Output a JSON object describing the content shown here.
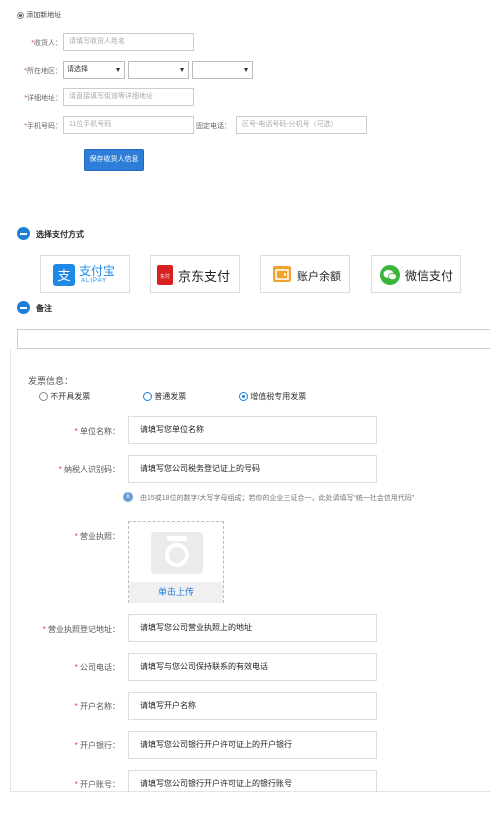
{
  "address": {
    "add_new_label": "添加新地址",
    "receiver": {
      "label": "收货人：",
      "placeholder": "请填写收货人姓名"
    },
    "region": {
      "label": "所在地区：",
      "province_value": "请选择",
      "city_value": "",
      "district_value": ""
    },
    "detail": {
      "label": "详细地址：",
      "placeholder": "请直接填写街道等详细地址"
    },
    "mobile": {
      "label": "手机号码：",
      "placeholder": "11位手机号码"
    },
    "phone": {
      "label": "固定电话：",
      "placeholder": "区号-电话号码-分机号（可选）"
    },
    "save_button": "保存收货人信息"
  },
  "payment": {
    "title": "选择支付方式",
    "methods": [
      {
        "name": "支付宝",
        "sub": "ALIPAY",
        "icon": "alipay-icon",
        "color": "#1e88e5"
      },
      {
        "name": "京东支付",
        "icon": "jd-pay-icon",
        "color": "#d7201f"
      },
      {
        "name": "账户余额",
        "icon": "wallet-icon",
        "color": "#f0a22c"
      },
      {
        "name": "微信支付",
        "icon": "wechat-icon",
        "color": "#3bb53b"
      }
    ]
  },
  "remarks": {
    "title": "备注"
  },
  "invoice": {
    "title": "发票信息：",
    "options": [
      "不开具发票",
      "普通发票",
      "增值税专用发票"
    ],
    "selected_option": "增值税专用发票",
    "fields": {
      "company_name": {
        "label": "单位名称：",
        "value": "请填写您单位名称"
      },
      "tax_id": {
        "label": "纳税人识别码：",
        "value": "请填写您公司税务登记证上的号码"
      },
      "tax_hint": "由15或18位的数字/大写字母组成；若你的企业三证合一，此处请填写“统一社会信用代码”",
      "license": {
        "label": "营业执照：",
        "upload_label": "单击上传"
      },
      "license_address": {
        "label": "营业执照登记地址：",
        "value": "请填写您公司营业执照上的地址"
      },
      "company_phone": {
        "label": "公司电话：",
        "value": "请填写与您公司保持联系的有效电话"
      },
      "account_name": {
        "label": "开户名称：",
        "value": "请填写开户名称"
      },
      "bank": {
        "label": "开户银行：",
        "value": "请填写您公司银行开户许可证上的开户银行"
      },
      "account_number": {
        "label": "开户账号：",
        "value": "请填写您公司银行开户许可证上的银行账号"
      }
    }
  }
}
